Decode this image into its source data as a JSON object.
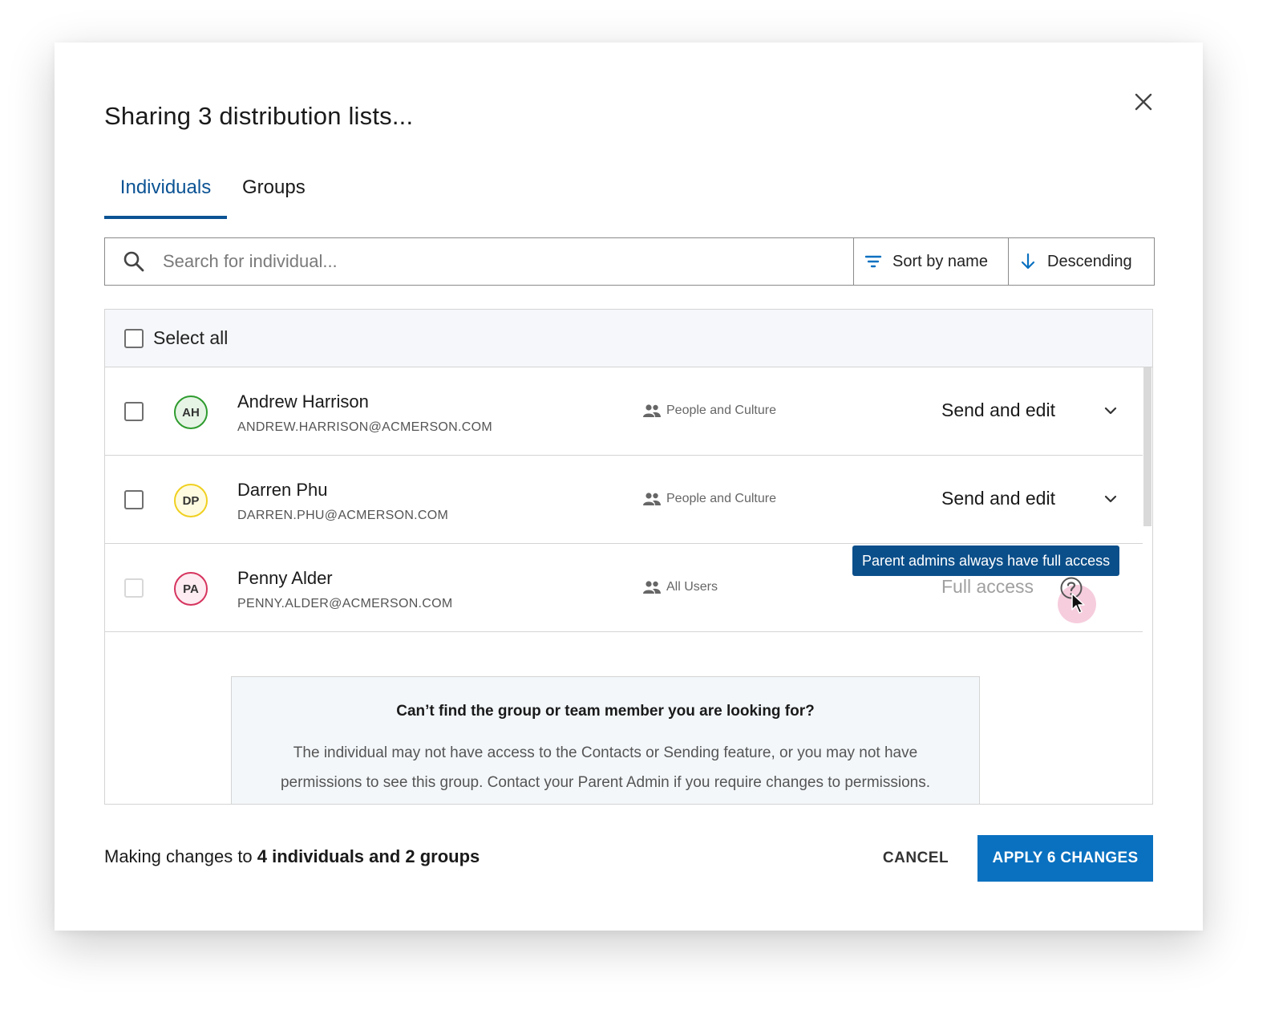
{
  "dialog": {
    "title": "Sharing 3 distribution lists...",
    "tabs": [
      {
        "label": "Individuals",
        "active": true
      },
      {
        "label": "Groups",
        "active": false
      }
    ],
    "search": {
      "placeholder": "Search for individual...",
      "value": ""
    },
    "sort": {
      "label": "Sort by name",
      "icon": "filter-icon"
    },
    "order": {
      "label": "Descending",
      "icon": "arrow-down-icon"
    },
    "select_all_label": "Select all",
    "rows": [
      {
        "initials": "AH",
        "name": "Andrew Harrison",
        "email": "ANDREW.HARRISON@ACMERSON.COM",
        "group": "People and Culture",
        "permission": "Send and edit",
        "avatar_color": "#2e9b2e",
        "avatar_bg": "#e6f4e6"
      },
      {
        "initials": "DP",
        "name": "Darren Phu",
        "email": "DARREN.PHU@ACMERSON.COM",
        "group": "People and Culture",
        "permission": "Send and edit",
        "avatar_color": "#f0d020",
        "avatar_bg": "#fffbe0"
      },
      {
        "initials": "PA",
        "name": "Penny Alder",
        "email": "PENNY.ALDER@ACMERSON.COM",
        "group": "All Users",
        "permission": "Full access",
        "avatar_color": "#d6335e",
        "avatar_bg": "#fdecf1",
        "disabled": true
      }
    ],
    "tooltip": "Parent admins always have full access",
    "info": {
      "title": "Can’t find the group or team member you are looking for?",
      "body": "The individual may not have access to the Contacts or Sending feature, or you may not have permissions to see this group. Contact your Parent Admin if you require changes to permissions."
    },
    "footer": {
      "prefix": "Making changes to ",
      "bold": "4 individuals and 2 groups",
      "cancel_label": "CANCEL",
      "apply_label": "APPLY 6 CHANGES"
    },
    "colors": {
      "accent": "#0b5394",
      "button": "#0a71c0",
      "tooltip_bg": "#0b4f8a"
    }
  }
}
